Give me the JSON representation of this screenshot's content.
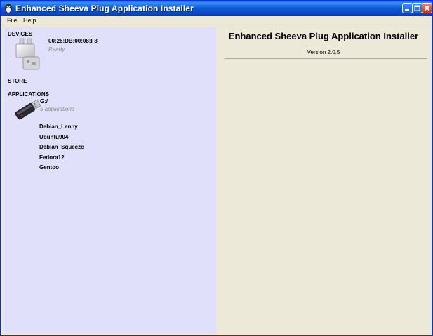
{
  "window": {
    "title": "Enhanced Sheeva Plug Application Installer"
  },
  "menu": {
    "items": [
      "File",
      "Help"
    ]
  },
  "sidebar": {
    "devices_label": "DEVICES",
    "device": {
      "name": "00:26:DB:00:08:F8",
      "status": "Ready",
      "icon": "plug-device-icon"
    },
    "store_label": "STORE",
    "applications_label": "APPLICATIONS",
    "drive": {
      "name": "G:/",
      "count": "5 applications",
      "icon": "usb-drive-icon"
    },
    "apps": [
      "Debian_Lenny",
      "Ubuntu904",
      "Debian_Squeeze",
      "Fedora12",
      "Gentoo"
    ]
  },
  "content": {
    "title": "Enhanced Sheeva Plug Application Installer",
    "version": "Version 2.0.5"
  },
  "colors": {
    "sidebar_bg": "#e0e0fa",
    "content_bg": "#ece9d8",
    "titlebar": "#0a5fd8"
  }
}
